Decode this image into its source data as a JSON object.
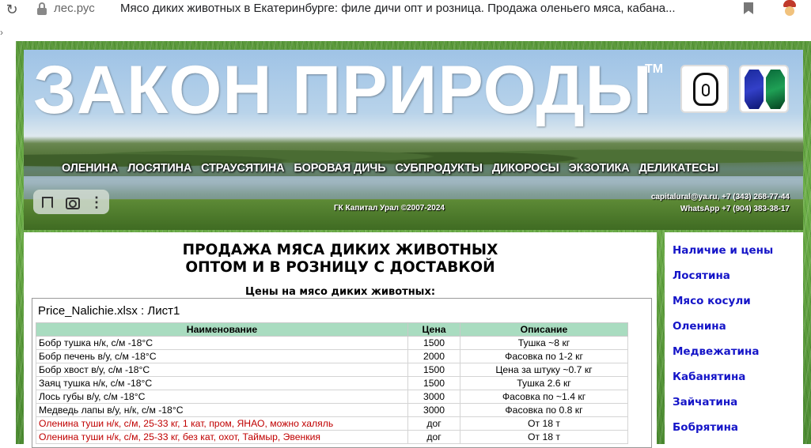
{
  "browser": {
    "domain": "лес.рус",
    "tab_title": "Мясо диких животных в Екатеринбурге: филе дичи опт и розница. Продажа оленьего мяса, кабана..."
  },
  "banner": {
    "site_title": "ЗАКОН ПРИРОДЫ",
    "trademark": "TM",
    "menu": [
      "ОЛЕНИНА",
      "ЛОСЯТИНА",
      "СТРАУСЯТИНА",
      "БОРОВАЯ ДИЧЬ",
      "СУБПРОДУКТЫ",
      "ДИКОРОСЫ",
      "ЭКЗОТИКА",
      "ДЕЛИКАТЕСЫ"
    ],
    "copyright": "ГК Капитал Урал ©2007-2024",
    "contact_line1": "capitalural@ya.ru, +7 (343) 268-77-44",
    "contact_line2": "WhatsApp +7 (904) 383-38-17"
  },
  "main": {
    "heading_line1": "ПРОДАЖА МЯСА ДИКИХ ЖИВОТНЫХ",
    "heading_line2": "ОПТОМ И В РОЗНИЦУ С ДОСТАВКОЙ",
    "subheading": "Цены на мясо диких животных:",
    "sheet_title": "Price_Nalichie.xlsx : Лист1",
    "columns": [
      "Наименование",
      "Цена",
      "Описание"
    ],
    "rows": [
      {
        "name": "Бобр тушка н/к, с/м -18°C",
        "price": "1500",
        "desc": "Тушка ~8 кг"
      },
      {
        "name": "Бобр печень в/у, с/м -18°C",
        "price": "2000",
        "desc": "Фасовка по 1-2 кг"
      },
      {
        "name": "Бобр хвост в/у, с/м -18°C",
        "price": "1500",
        "desc": "Цена за штуку ~0.7 кг"
      },
      {
        "name": "Заяц тушка н/к, с/м -18°C",
        "price": "1500",
        "desc": "Тушка 2.6 кг"
      },
      {
        "name": "Лось губы в/у, с/м -18°C",
        "price": "3000",
        "desc": "Фасовка по ~1.4 кг"
      },
      {
        "name": "Медведь лапы в/у, н/к, с/м -18°C",
        "price": "3000",
        "desc": "Фасовка по 0.8 кг"
      },
      {
        "name": "Оленина туши н/к, с/м, 25-33 кг, 1 кат, пром, ЯНАО, можно халяль",
        "price": "дог",
        "desc": "От 18 т"
      },
      {
        "name": "Оленина туши н/к, с/м, 25-33 кг, без кат, охот, Таймыр, Эвенкия",
        "price": "дог",
        "desc": "От 18 т"
      }
    ]
  },
  "sidebar": {
    "items": [
      "Наличие и цены",
      "Лосятина",
      "Мясо косули",
      "Оленина",
      "Медвежатина",
      "Кабанятина",
      "Зайчатина",
      "Бобрятина"
    ]
  }
}
